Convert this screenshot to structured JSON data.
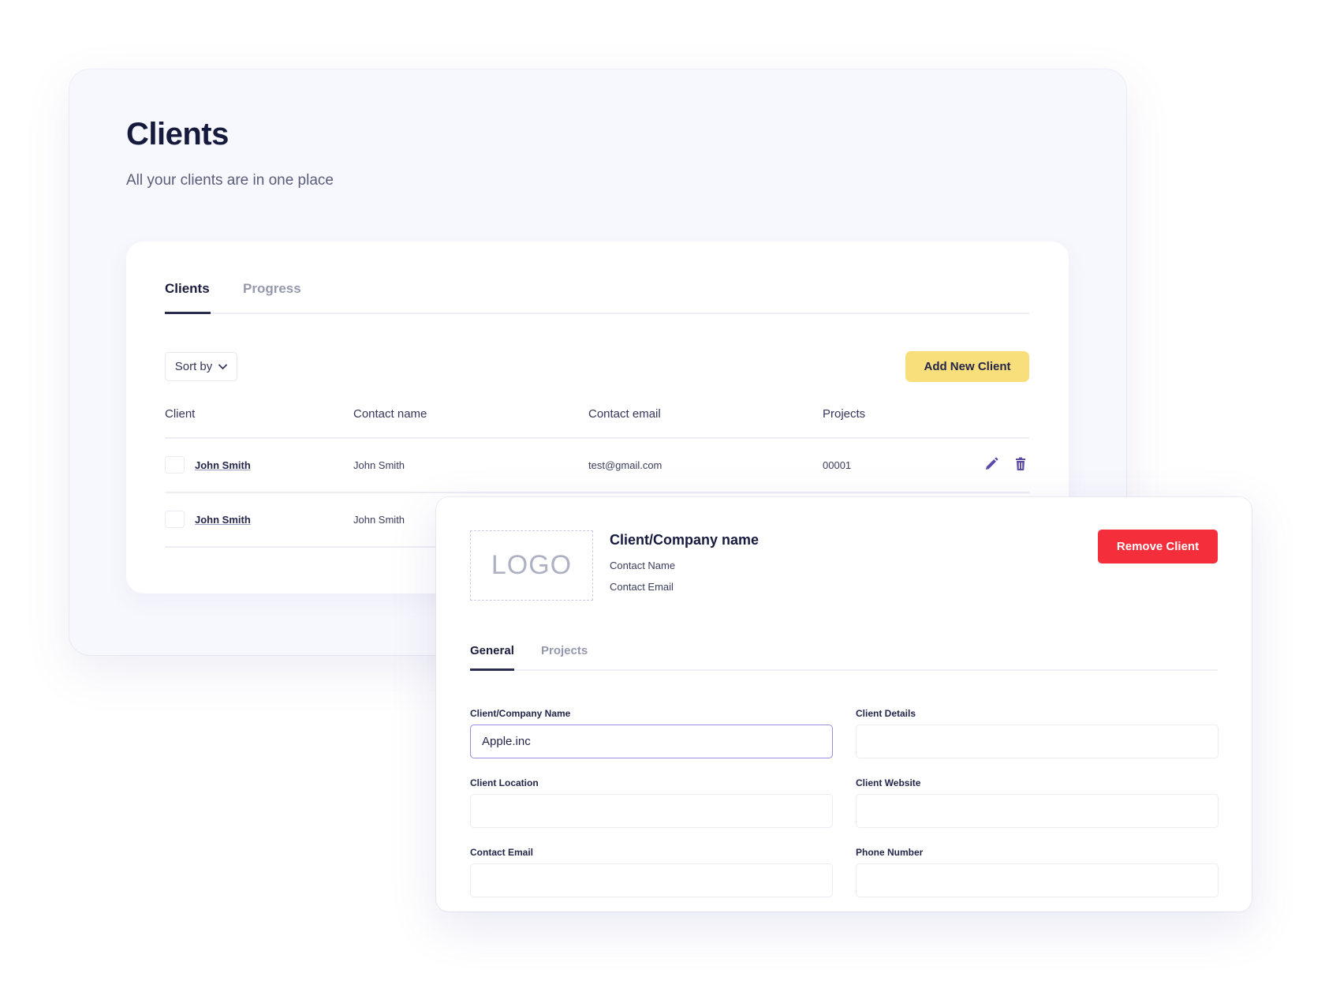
{
  "page": {
    "title": "Clients",
    "subtitle": "All your clients are in one place"
  },
  "list": {
    "tabs": [
      {
        "label": "Clients",
        "active": true
      },
      {
        "label": "Progress",
        "active": false
      }
    ],
    "sort_label": "Sort by",
    "add_button": "Add New Client",
    "columns": [
      "Client",
      "Contact name",
      "Contact email",
      "Projects"
    ],
    "rows": [
      {
        "client": "John Smith",
        "contact_name": "John Smith",
        "contact_email": "test@gmail.com",
        "projects": "00001"
      },
      {
        "client": "John Smith",
        "contact_name": "John Smith",
        "contact_email": "",
        "projects": ""
      }
    ],
    "icon_color": "#5e4ba8"
  },
  "detail": {
    "logo_text": "LOGO",
    "company_name": "Client/Company name",
    "contact_name": "Contact Name",
    "contact_email": "Contact Email",
    "remove_button": "Remove Client",
    "remove_color": "#f52e3c",
    "tabs": [
      {
        "label": "General",
        "active": true
      },
      {
        "label": "Projects",
        "active": false
      }
    ],
    "fields": [
      {
        "label": "Client/Company Name",
        "value": "Apple.inc"
      },
      {
        "label": "Client Details",
        "value": ""
      },
      {
        "label": "Client Location",
        "value": ""
      },
      {
        "label": "Client Website",
        "value": ""
      },
      {
        "label": "Contact Email",
        "value": ""
      },
      {
        "label": "Phone Number",
        "value": ""
      }
    ]
  },
  "colors": {
    "accent_yellow": "#f8df7c",
    "text_dark": "#161a3d",
    "focus_border": "#9a8ae0"
  }
}
